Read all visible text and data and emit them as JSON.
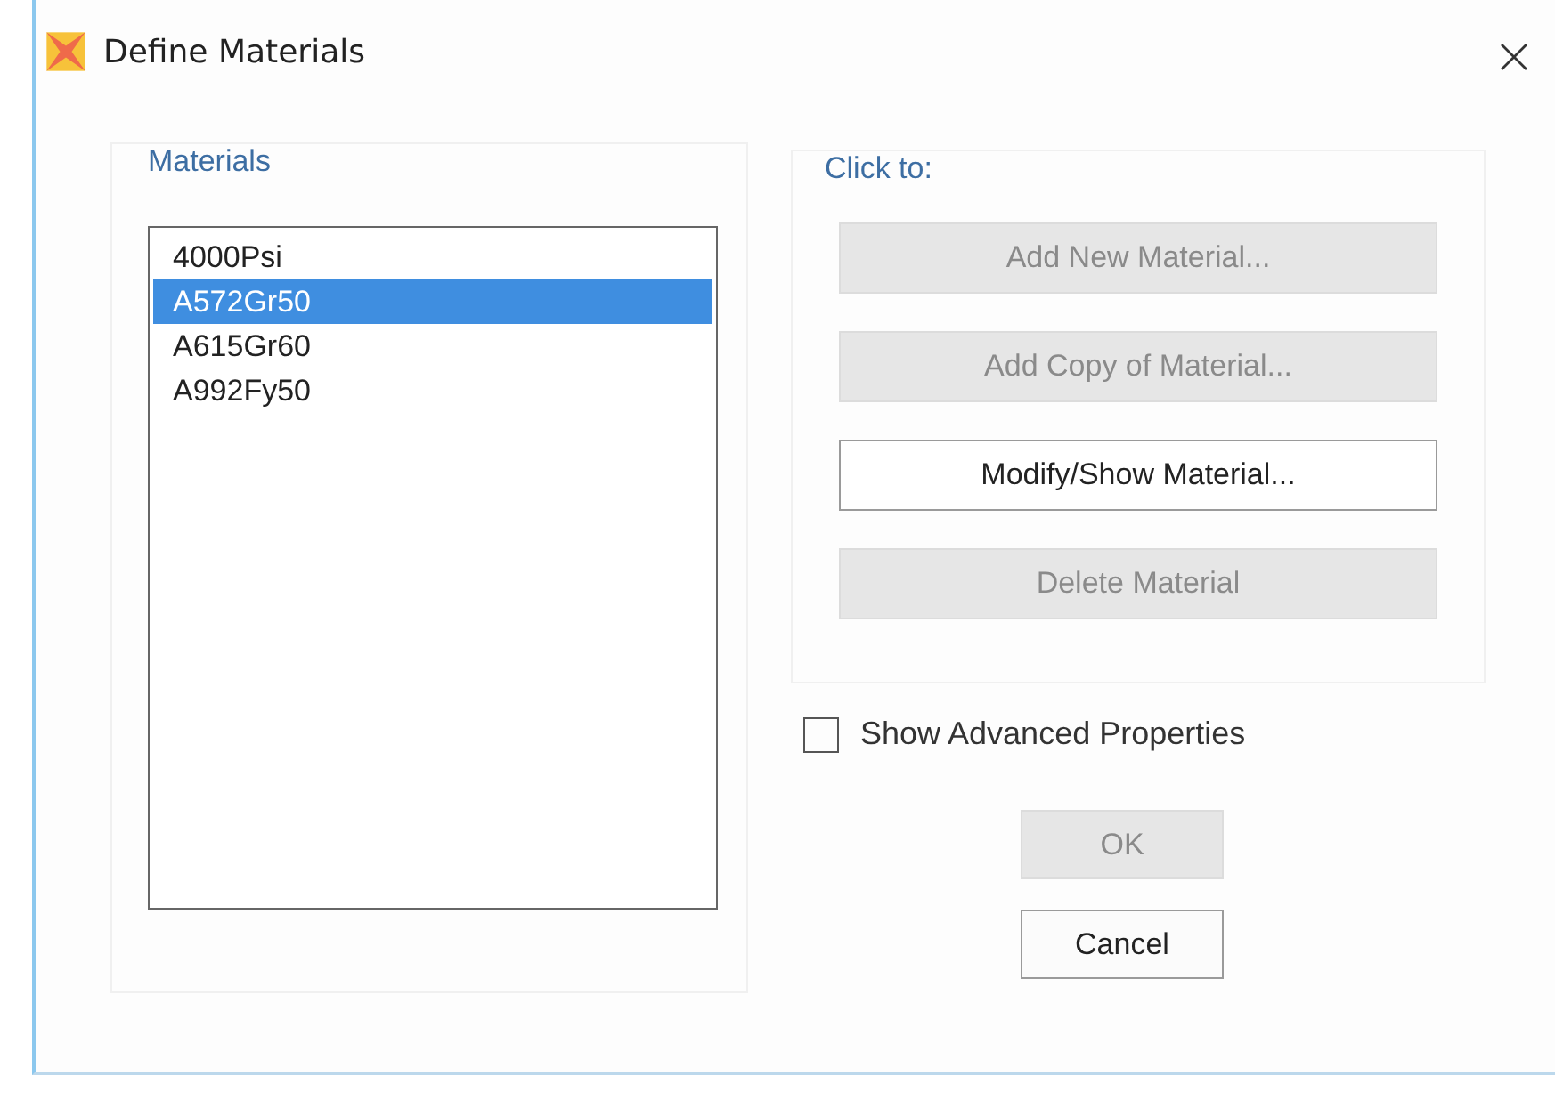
{
  "window": {
    "title": "Define Materials"
  },
  "materials": {
    "label": "Materials",
    "items": [
      {
        "name": "4000Psi",
        "selected": false
      },
      {
        "name": "A572Gr50",
        "selected": true
      },
      {
        "name": "A615Gr60",
        "selected": false
      },
      {
        "name": "A992Fy50",
        "selected": false
      }
    ]
  },
  "actions": {
    "label": "Click to:",
    "buttons": [
      {
        "label": "Add New Material...",
        "disabled": true
      },
      {
        "label": "Add Copy of Material...",
        "disabled": true
      },
      {
        "label": "Modify/Show Material...",
        "disabled": false
      },
      {
        "label": "Delete Material",
        "disabled": true
      }
    ]
  },
  "show_advanced": {
    "label": "Show Advanced Properties",
    "checked": false
  },
  "dialog_buttons": [
    {
      "label": "OK",
      "disabled": true
    },
    {
      "label": "Cancel",
      "disabled": false
    }
  ]
}
